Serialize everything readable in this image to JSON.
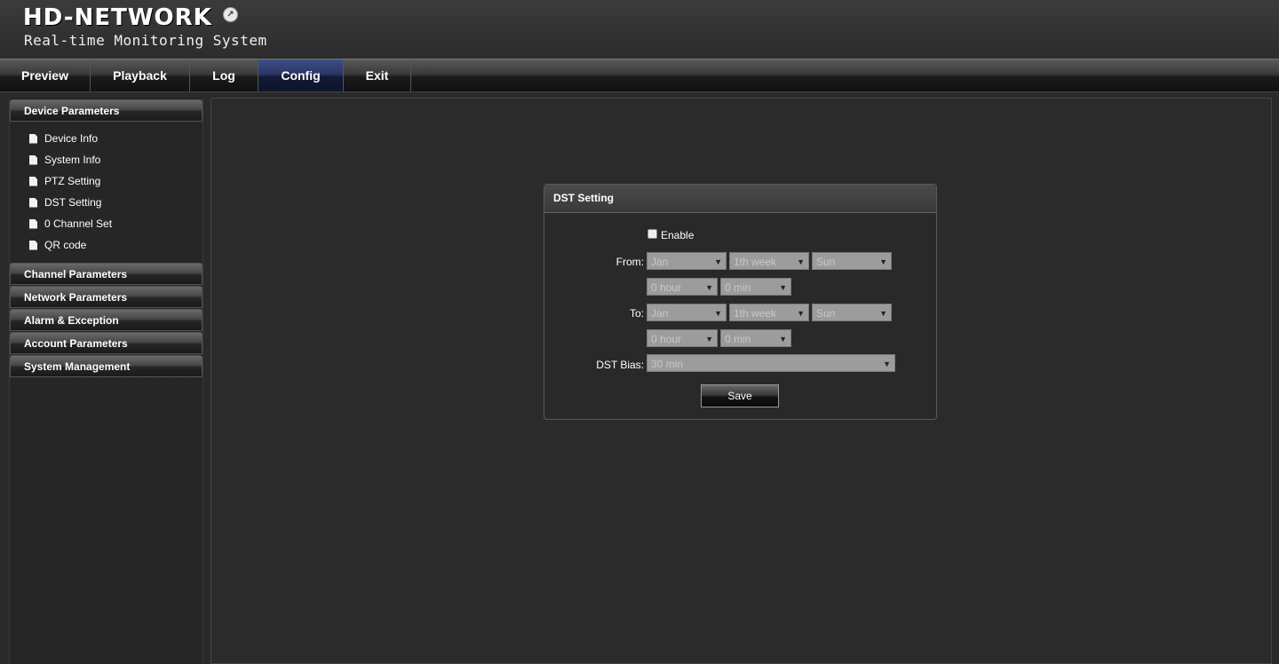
{
  "header": {
    "logo": "HD-NETWORK",
    "subtitle": "Real-time Monitoring System"
  },
  "nav": {
    "tabs": [
      "Preview",
      "Playback",
      "Log",
      "Config",
      "Exit"
    ],
    "active": "Config"
  },
  "sidebar": {
    "groups": [
      {
        "label": "Device Parameters",
        "items": [
          "Device Info",
          "System Info",
          "PTZ Setting",
          "DST Setting",
          "0 Channel Set",
          "QR code"
        ]
      },
      {
        "label": "Channel Parameters"
      },
      {
        "label": "Network Parameters"
      },
      {
        "label": "Alarm & Exception"
      },
      {
        "label": "Account Parameters"
      },
      {
        "label": "System Management"
      }
    ]
  },
  "dst": {
    "title": "DST Setting",
    "enable_label": "Enable",
    "enabled": false,
    "from_label": "From:",
    "to_label": "To:",
    "from": {
      "month": "Jan",
      "week": "1th week",
      "day": "Sun",
      "hour": "0 hour",
      "min": "0 min"
    },
    "to": {
      "month": "Jan",
      "week": "1th week",
      "day": "Sun",
      "hour": "0 hour",
      "min": "0 min"
    },
    "bias_label": "DST Bias:",
    "bias": "30 min",
    "save_label": "Save"
  },
  "icons": {
    "dropdown": "chevron-down-icon",
    "doc": "document-icon"
  }
}
